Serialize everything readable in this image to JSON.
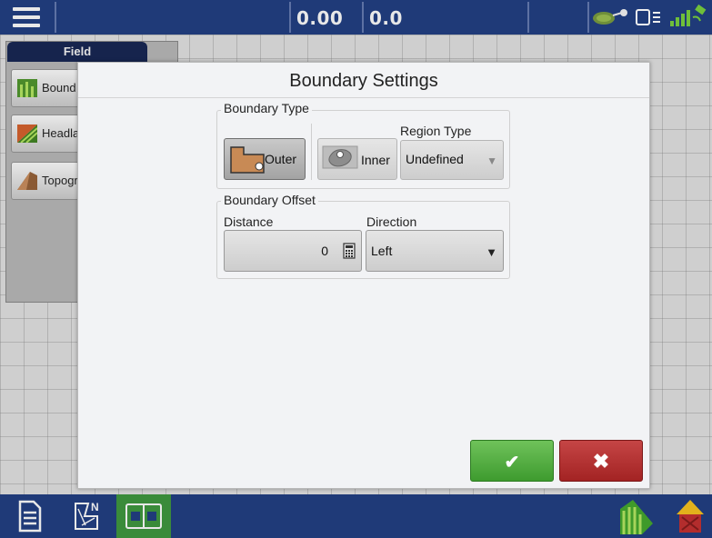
{
  "topbar": {
    "readout_left": "0.00",
    "readout_right": "0.0",
    "icons": [
      "menu-icon",
      "gps-antenna-icon",
      "display-icon",
      "satellite-signal-icon"
    ]
  },
  "field_panel": {
    "tab": "Field",
    "items": [
      {
        "label": "Bound",
        "icon": "boundary-icon"
      },
      {
        "label": "Headla",
        "icon": "headland-icon"
      },
      {
        "label": "Topogr",
        "icon": "topography-icon"
      }
    ]
  },
  "dialog": {
    "title": "Boundary Settings",
    "boundary_type": {
      "label": "Boundary Type",
      "outer_label": "Outer",
      "inner_label": "Inner",
      "selected": "Outer",
      "region_type_label": "Region Type",
      "region_type_value": "Undefined"
    },
    "boundary_offset": {
      "label": "Boundary Offset",
      "distance_label": "Distance",
      "distance_value": "0",
      "direction_label": "Direction",
      "direction_value": "Left"
    },
    "ok_glyph": "✔",
    "cancel_glyph": "✖"
  },
  "bottombar": {
    "icons": [
      "document-icon",
      "map-grid-icon",
      "split-view-icon",
      "field-coverage-icon",
      "barn-icon"
    ]
  },
  "colors": {
    "bar": "#1f3a78",
    "ok": "#4caf3a",
    "cancel": "#b32d2d",
    "active_tab": "#3a8b3a"
  }
}
